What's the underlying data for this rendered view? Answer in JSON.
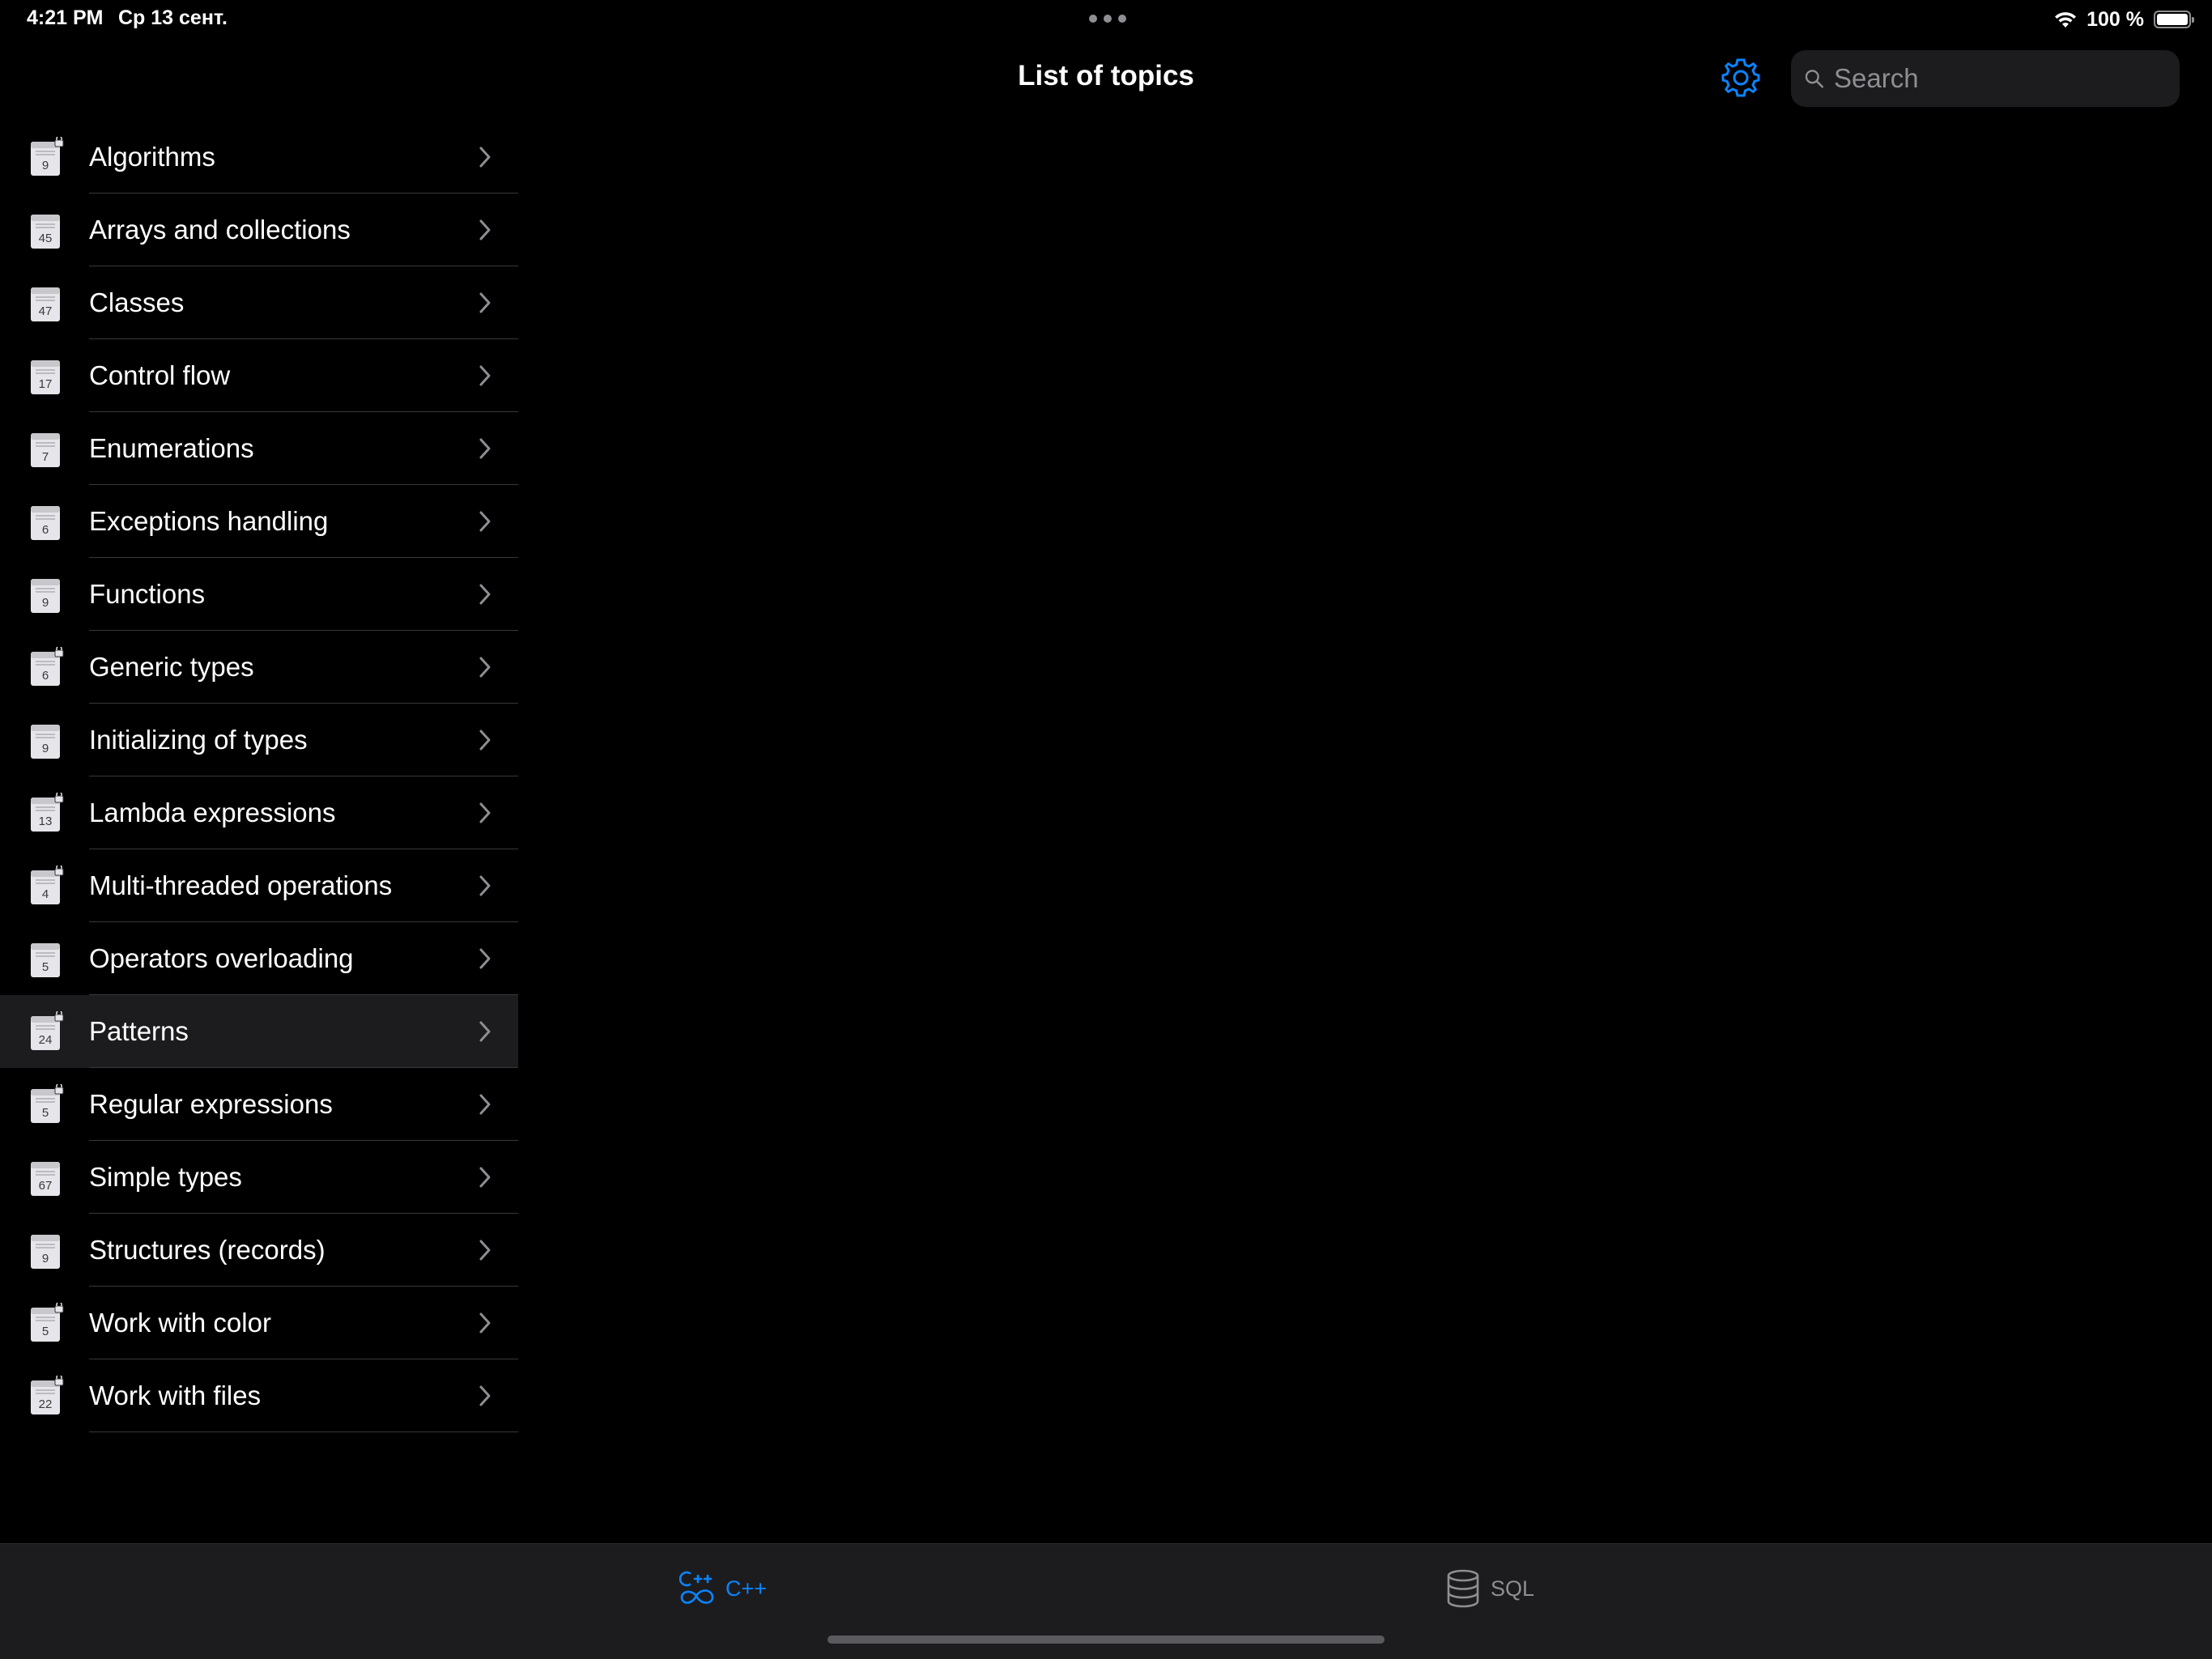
{
  "status_bar": {
    "time": "4:21 PM",
    "date": "Ср 13 сент.",
    "battery_percent": "100 %",
    "battery_level": 1.0
  },
  "nav": {
    "title": "List of topics",
    "settings_icon": "gear-icon",
    "search_placeholder": "Search"
  },
  "topics": [
    {
      "label": "Algorithms",
      "count": "9",
      "locked": true
    },
    {
      "label": "Arrays and collections",
      "count": "45",
      "locked": false
    },
    {
      "label": "Classes",
      "count": "47",
      "locked": false
    },
    {
      "label": "Control flow",
      "count": "17",
      "locked": false
    },
    {
      "label": "Enumerations",
      "count": "7",
      "locked": false
    },
    {
      "label": "Exceptions handling",
      "count": "6",
      "locked": false
    },
    {
      "label": "Functions",
      "count": "9",
      "locked": false
    },
    {
      "label": "Generic types",
      "count": "6",
      "locked": true
    },
    {
      "label": "Initializing of types",
      "count": "9",
      "locked": false
    },
    {
      "label": "Lambda expressions",
      "count": "13",
      "locked": true
    },
    {
      "label": "Multi-threaded operations",
      "count": "4",
      "locked": true
    },
    {
      "label": "Operators overloading",
      "count": "5",
      "locked": false
    },
    {
      "label": "Patterns",
      "count": "24",
      "locked": true,
      "selected": true
    },
    {
      "label": "Regular expressions",
      "count": "5",
      "locked": true
    },
    {
      "label": "Simple types",
      "count": "67",
      "locked": false
    },
    {
      "label": "Structures (records)",
      "count": "9",
      "locked": false
    },
    {
      "label": "Work with color",
      "count": "5",
      "locked": true
    },
    {
      "label": "Work with files",
      "count": "22",
      "locked": true
    }
  ],
  "tabs": [
    {
      "label": "C++",
      "icon": "cpp-icon",
      "active": true
    },
    {
      "label": "SQL",
      "icon": "database-icon",
      "active": false
    }
  ],
  "colors": {
    "accent": "#0a84ff",
    "background": "#000000",
    "separator": "#38383a",
    "selected_row": "#1c1c1e",
    "secondary_text": "#8e8e93"
  }
}
